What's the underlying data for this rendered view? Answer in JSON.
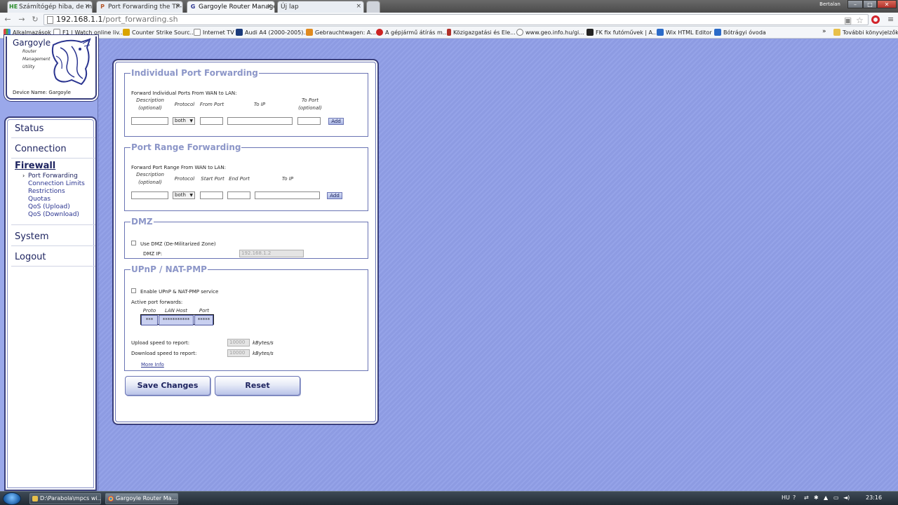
{
  "browser": {
    "tabs": [
      {
        "title": "Számítógép hiba, de mi a",
        "favicon": "HE"
      },
      {
        "title": "Port Forwarding the TP-L",
        "favicon": "P"
      },
      {
        "title": "Gargoyle Router Managem",
        "favicon": "G"
      },
      {
        "title": "Új lap",
        "favicon": ""
      }
    ],
    "user_label": "Bertalan",
    "url_host": "192.168.1.1",
    "url_path": "/port_forwarding.sh",
    "bookmarks": [
      "Alkalmazások",
      "F1 | Watch online liv...",
      "Counter Strike Sourc...",
      "Internet TV",
      "Audi A4 (2000-2005)...",
      "Gebrauchtwagen: A...",
      "A gépjármű átírás m...",
      "Közigazgatási és Ele...",
      "www.geo.info.hu/gi...",
      "FK fix futóművek | A...",
      "Wix HTML Editor",
      "Bótrágyi óvoda"
    ],
    "bookmarks_more": "»",
    "other_bookmarks": "További könyvjelzők",
    "window_controls": [
      "–",
      "□",
      "✕"
    ]
  },
  "sidebar": {
    "logo_title": "Gargoyle",
    "logo_lines": [
      "Router",
      "Management",
      "Utility"
    ],
    "device_name": "Device Name: Gargoyle",
    "nav": {
      "status": "Status",
      "connection": "Connection",
      "firewall": "Firewall",
      "system": "System",
      "logout": "Logout"
    },
    "firewall_items": [
      "Port Forwarding",
      "Connection Limits",
      "Restrictions",
      "Quotas",
      "QoS (Upload)",
      "QoS (Download)"
    ],
    "current_marker": "›"
  },
  "individual": {
    "legend": "Individual Port Forwarding",
    "intro": "Forward Individual Ports From WAN to LAN:",
    "col_description": "Description",
    "col_optional": "(optional)",
    "col_protocol": "Protocol",
    "col_from_port": "From Port",
    "col_to_ip": "To IP",
    "col_to_port": "To Port",
    "protocol_value": "both",
    "add_label": "Add"
  },
  "range": {
    "legend": "Port Range Forwarding",
    "intro": "Forward Port Range From WAN to LAN:",
    "col_description": "Description",
    "col_optional": "(optional)",
    "col_protocol": "Protocol",
    "col_start_port": "Start Port",
    "col_end_port": "End Port",
    "col_to_ip": "To IP",
    "protocol_value": "both",
    "add_label": "Add"
  },
  "dmz": {
    "legend": "DMZ",
    "use_label": "Use DMZ (De-Militarized Zone)",
    "ip_label": "DMZ IP:",
    "ip_value": "192.168.1.2"
  },
  "upnp": {
    "legend": "UPnP / NAT-PMP",
    "enable_label": "Enable UPnP & NAT-PMP service",
    "active_label": "Active port forwards:",
    "table_headers": [
      "Proto",
      "LAN Host",
      "Port"
    ],
    "table_row": [
      "***",
      "***********",
      "*****"
    ],
    "upload_label": "Upload speed to report:",
    "upload_value": "10000",
    "download_label": "Download speed to report:",
    "download_value": "10000",
    "unit": "kBytes/s",
    "more_info": "More Info"
  },
  "actions": {
    "save": "Save Changes",
    "reset": "Reset"
  },
  "taskbar": {
    "tasks": [
      "D:\\Parabola\\mpcs wi...",
      "Gargoyle Router Ma..."
    ],
    "lang": "HU",
    "clock": "23:16"
  }
}
